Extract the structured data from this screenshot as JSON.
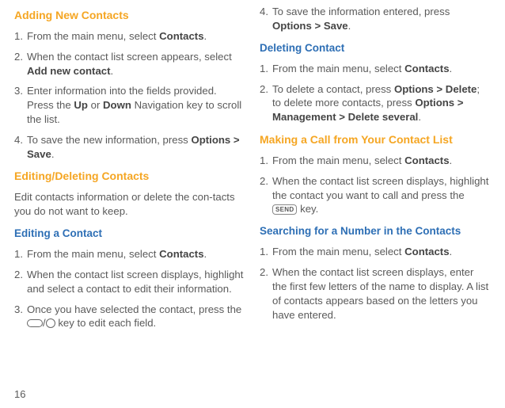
{
  "page_number": "16",
  "col1": {
    "h_adding": "Adding New Contacts",
    "adding": [
      {
        "n": "1.",
        "html": "From the main menu, select <b>Contacts</b>."
      },
      {
        "n": "2.",
        "html": "When the contact list screen appears, select <b>Add new contact</b>."
      },
      {
        "n": "3.",
        "html": "Enter information into the fields provided. Press the <b>Up</b> or <b>Down</b> Navigation key to scroll the list."
      },
      {
        "n": "4.",
        "html": "To save the new information, press <b>Options > Save</b>."
      }
    ],
    "h_editdel": "Editing/Deleting Contacts",
    "editdel_intro": "Edit contacts information or delete the con-tacts you do not want to keep.",
    "h_editing": "Editing a Contact",
    "editing": [
      {
        "n": "1.",
        "html": "From the main menu, select <b>Contacts</b>."
      },
      {
        "n": "2.",
        "html": "When the contact list screen displays, highlight and select a contact to edit their information."
      },
      {
        "n": "3.",
        "html": "Once you have selected the contact, press the <span class=\"key-oval\" data-name=\"softkey-icon\" data-interactable=\"false\"></span>/<span class=\"key-circle\" data-name=\"ok-key-icon\" data-interactable=\"false\"></span> key to edit each field."
      }
    ]
  },
  "col2": {
    "editing_cont": [
      {
        "n": "4.",
        "html": "To save the information entered, press <b>Options > Save</b>."
      }
    ],
    "h_deleting": "Deleting Contact",
    "deleting": [
      {
        "n": "1.",
        "html": "From the main menu, select <b>Contacts</b>."
      },
      {
        "n": "2.",
        "html": "To delete a contact, press <b>Options > Delete</b>; to delete more contacts, press <b>Options > Management > Delete several</b>."
      }
    ],
    "h_call": "Making a Call from Your Contact List",
    "call": [
      {
        "n": "1.",
        "html": "From the main menu, select <b>Contacts</b>."
      },
      {
        "n": "2.",
        "html": "When the contact list screen displays, highlight the contact you want to call and press the <span class=\"key-send\" data-name=\"send-key-icon\" data-interactable=\"false\">SEND</span> key."
      }
    ],
    "h_search": "Searching for a Number in the Contacts",
    "search": [
      {
        "n": "1.",
        "html": "From the main menu, select <b>Contacts</b>."
      },
      {
        "n": "2.",
        "html": "When the contact list screen displays, enter the first few letters of the name to display. A list of contacts appears based on the letters you have entered."
      }
    ]
  }
}
